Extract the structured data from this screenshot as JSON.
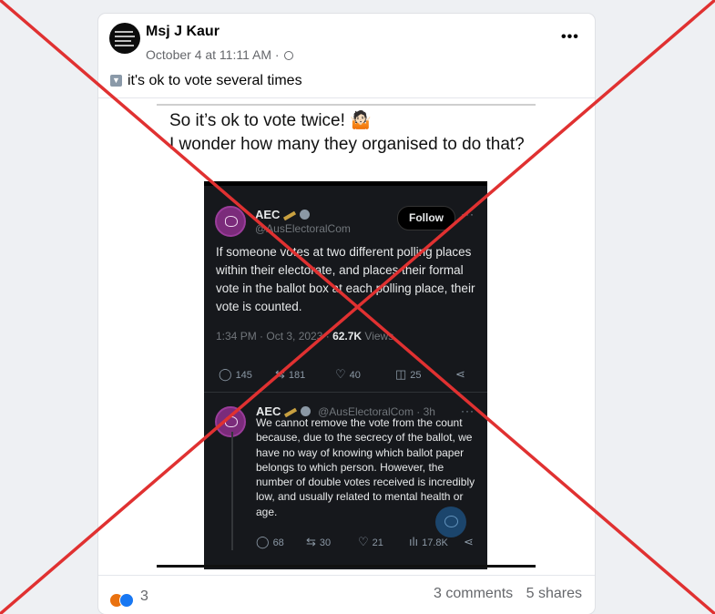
{
  "post": {
    "author": "Msj J Kaur",
    "timestamp": "October 4 at 11:11 AM",
    "separator": "·",
    "more_label": "•••",
    "caption": "it's ok to vote several times"
  },
  "shared_image": {
    "overlay_text": "So it’s ok to vote twice! 🤷🏻\nI wonder how many they organised to do that?",
    "tweet": {
      "name": "AEC",
      "handle": "@AusElectoralCom",
      "follow_label": "Follow",
      "more_label": "···",
      "body": "If someone votes at two different polling places within their electorate, and places their formal vote in the ballot box at each polling place, their vote is counted.",
      "time": "1:34 PM · Oct 3, 2023 · ",
      "views_count": "62.7K",
      "views_label": " Views",
      "replies": "145",
      "retweets": "181",
      "likes": "40",
      "bookmarks": "25"
    },
    "reply": {
      "name": "AEC",
      "handle_time": "@AusElectoralCom · 3h",
      "more_label": "···",
      "body": "We cannot remove the vote from the count because, due to the secrecy of the ballot, we have no way of knowing which ballot paper belongs to which person. However, the number of double votes received is incredibly low, and usually related to mental health or age.",
      "replies": "68",
      "retweets": "30",
      "likes": "21",
      "views": "17.8K"
    }
  },
  "footer": {
    "reaction_count": "3",
    "comments": "3 comments",
    "shares": "5 shares"
  },
  "colors": {
    "cross": "#e03131",
    "facebook_blue": "#1877f2",
    "tweet_bg": "#16181c"
  },
  "icons": [
    "globe-icon",
    "more-icon",
    "reply-icon",
    "retweet-icon",
    "like-icon",
    "bookmark-icon",
    "share-icon",
    "views-icon",
    "verified-icon",
    "angry-reaction-icon",
    "like-reaction-icon"
  ]
}
